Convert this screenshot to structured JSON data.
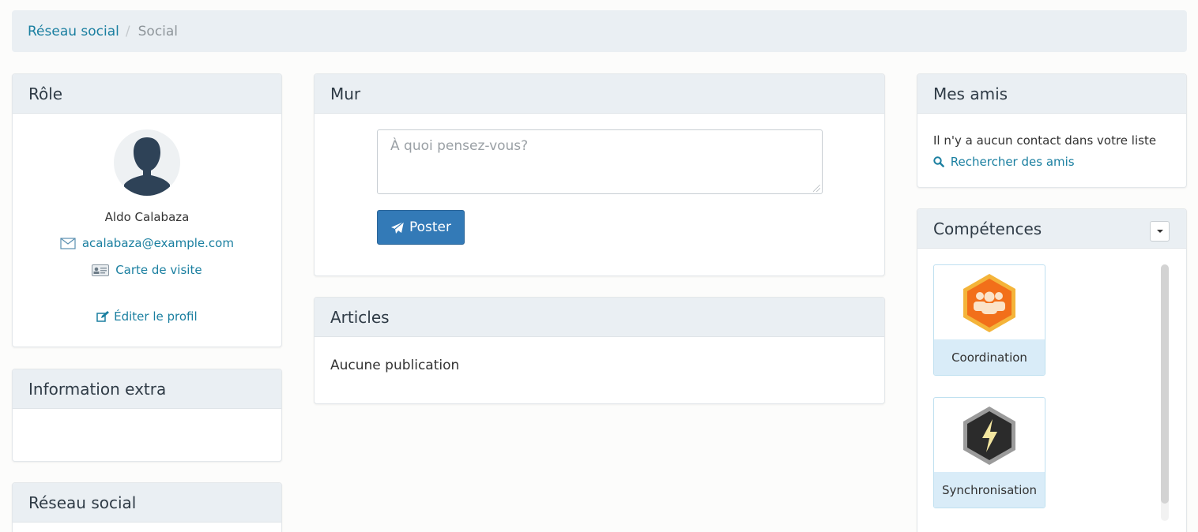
{
  "breadcrumb": {
    "items": [
      "Réseau social",
      "Social"
    ],
    "separator": "/"
  },
  "role": {
    "heading": "Rôle",
    "name": "Aldo Calabaza",
    "email": "acalabaza@example.com",
    "card_label": "Carte de visite",
    "edit_label": "Éditer le profil"
  },
  "extra": {
    "heading": "Information extra"
  },
  "social": {
    "heading": "Réseau social"
  },
  "wall": {
    "heading": "Mur",
    "textarea_placeholder": "À quoi pensez-vous?",
    "post_label": "Poster"
  },
  "articles": {
    "heading": "Articles",
    "empty_text": "Aucune publication"
  },
  "friends": {
    "heading": "Mes amis",
    "empty_text": "Il n'y a aucun contact dans votre liste",
    "search_label": "Rechercher des amis"
  },
  "skills": {
    "heading": "Compétences",
    "items": [
      {
        "label": "Coordination",
        "icon": "people-group-badge-icon"
      },
      {
        "label": "Synchronisation",
        "icon": "lightning-badge-icon"
      }
    ]
  },
  "colors": {
    "link": "#1a7fa0",
    "panel_heading_bg": "#eaeff3",
    "primary_button": "#337ab7",
    "skill_label_bg": "#d9ecf8"
  }
}
